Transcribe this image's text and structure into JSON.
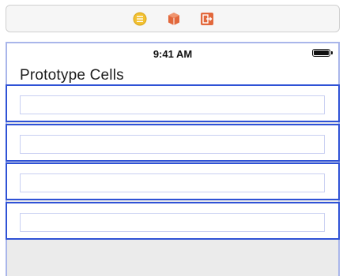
{
  "scene_dock": {
    "icons": [
      "view-controller-icon",
      "first-responder-icon",
      "exit-icon"
    ],
    "colors": {
      "controller": "#f2c131",
      "first_responder": "#e2683c",
      "exit": "#e2683c"
    }
  },
  "status_bar": {
    "time": "9:41 AM",
    "battery_icon": "battery-icon"
  },
  "table": {
    "section_header": "Prototype Cells",
    "cells": [
      {
        "label": ""
      },
      {
        "label": ""
      },
      {
        "label": ""
      },
      {
        "label": ""
      }
    ]
  },
  "colors": {
    "selection_border": "#2f52d6",
    "scene_border": "#a9b6ea",
    "content_view_border": "#c8cff2",
    "table_background": "#ebebeb"
  }
}
